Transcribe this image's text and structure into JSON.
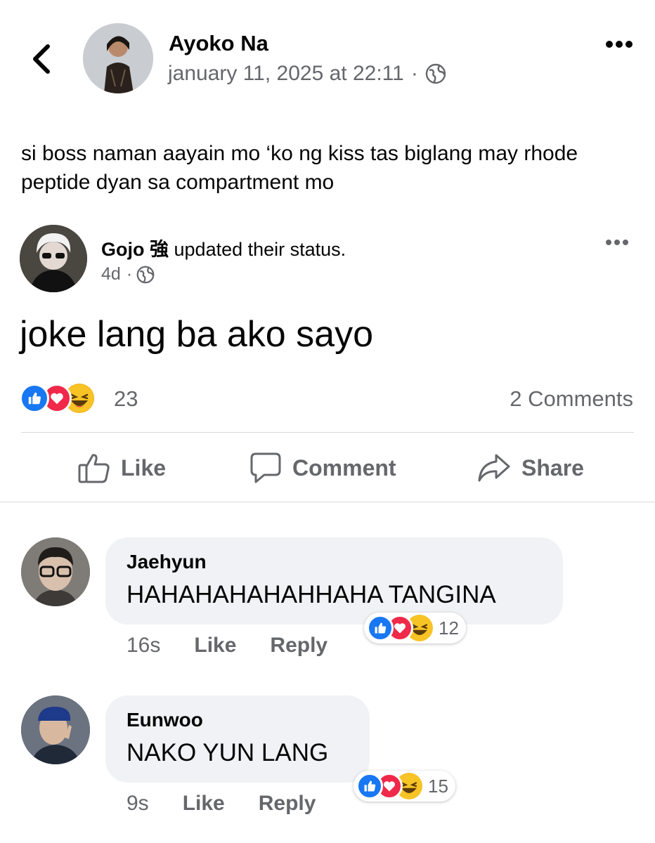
{
  "header": {
    "author": "Ayoko Na",
    "timestamp": "january 11, 2025 at 22:11",
    "separator": "·",
    "privacy_icon": "globe-icon",
    "more_icon": "more-options-icon"
  },
  "post": {
    "text": "si boss naman aayain mo ‘ko ng kiss tas biglang may rhode peptide dyan sa compartment mo"
  },
  "shared_post": {
    "author": "Gojo 強",
    "action": "updated their status.",
    "time": "4d",
    "separator": "·",
    "privacy_icon": "globe-icon",
    "status_text": "joke lang ba ako sayo"
  },
  "reactions": {
    "types": [
      "like",
      "love",
      "haha"
    ],
    "count": "23",
    "comments": "2 Comments"
  },
  "actions": {
    "like": "Like",
    "comment": "Comment",
    "share": "Share"
  },
  "comments": [
    {
      "name": "Jaehyun",
      "text": "HAHAHAHAHAHHAHA TANGINA",
      "time": "16s",
      "like": "Like",
      "reply": "Reply",
      "reaction_count": "12"
    },
    {
      "name": "Eunwoo",
      "text": "NAKO YUN LANG",
      "time": "9s",
      "like": "Like",
      "reply": "Reply",
      "reaction_count": "15"
    }
  ],
  "colors": {
    "like_blue": "#1877f2",
    "love_red": "#f02849",
    "haha_yellow": "#f7b125",
    "muted_text": "#65676b",
    "bubble_bg": "#f0f2f5"
  }
}
